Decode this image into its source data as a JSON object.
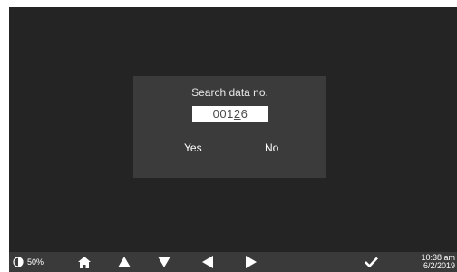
{
  "dialog": {
    "title": "Search data no.",
    "value_prefix": "001",
    "value_cursor": "2",
    "value_suffix": "6",
    "yes_label": "Yes",
    "no_label": "No"
  },
  "status": {
    "battery_label": "50%",
    "battery_level": 0.5,
    "time": "10:38 am",
    "date": "6/2/2019"
  },
  "toolbar": {
    "icons": [
      "home-icon",
      "up-arrow-icon",
      "down-arrow-icon",
      "left-arrow-icon",
      "right-arrow-icon",
      "check-icon"
    ]
  },
  "colors": {
    "background": "#242424",
    "dialog": "#3b3b3b",
    "toolbar": "#3a3a3a",
    "text": "#ffffff"
  }
}
